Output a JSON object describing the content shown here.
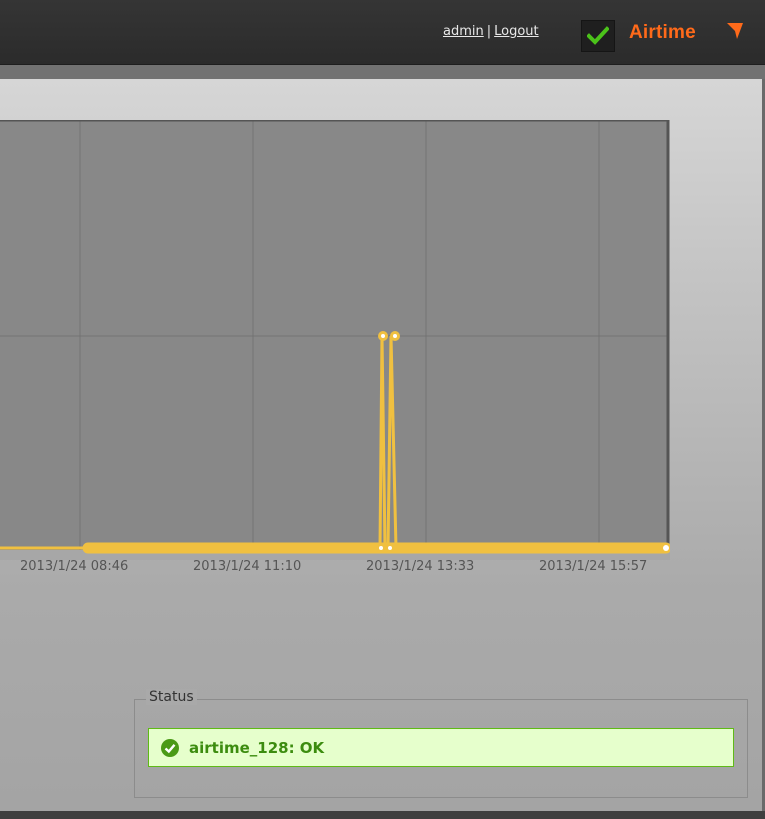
{
  "header": {
    "user_label": "admin",
    "separator": "|",
    "logout_label": "Logout",
    "brand": "Airtime",
    "status_icon": "checkmark-icon"
  },
  "chart_data": {
    "type": "line",
    "x_ticks": [
      "2013/1/24 08:46",
      "2013/1/24 11:10",
      "2013/1/24 13:33",
      "2013/1/24 15:57"
    ],
    "series": [
      {
        "color": "#f0c040",
        "points": [
          {
            "x": "2013/1/24 07:58",
            "y": 0
          },
          {
            "x": "2013/1/24 13:30",
            "y": 1
          },
          {
            "x": "2013/1/24 13:40",
            "y": 1
          },
          {
            "x": "2013/1/24 16:50",
            "y": 0
          }
        ]
      }
    ],
    "grid": true
  },
  "status": {
    "legend": "Status",
    "message": "airtime_128: OK",
    "ok_color": "#3c8c0f"
  }
}
